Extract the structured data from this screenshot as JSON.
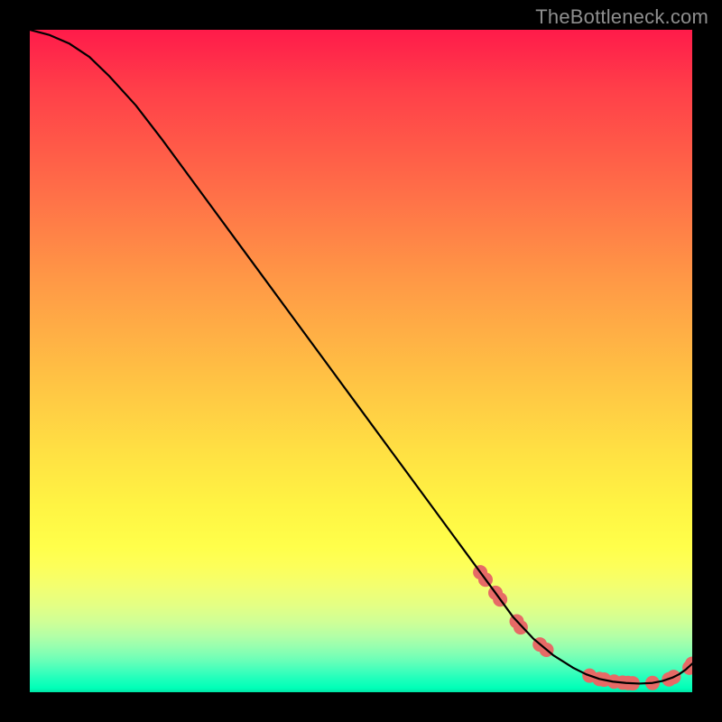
{
  "watermark": "TheBottleneck.com",
  "chart_data": {
    "type": "line",
    "title": "",
    "xlabel": "",
    "ylabel": "",
    "xlim": [
      0,
      100
    ],
    "ylim": [
      0,
      100
    ],
    "grid": false,
    "legend": false,
    "series": [
      {
        "name": "curve",
        "color": "#000000",
        "x": [
          0,
          3,
          6,
          9,
          12,
          16,
          20,
          25,
          30,
          35,
          40,
          45,
          50,
          55,
          60,
          65,
          70,
          73,
          76,
          79,
          82,
          84,
          86,
          88,
          90,
          92,
          94,
          95.5,
          97,
          98,
          99,
          100
        ],
        "y": [
          100,
          99.2,
          97.9,
          95.9,
          93.0,
          88.6,
          83.4,
          76.6,
          69.8,
          63.0,
          56.2,
          49.4,
          42.6,
          35.8,
          29.0,
          22.2,
          15.4,
          11.3,
          8.1,
          5.6,
          3.7,
          2.7,
          2.0,
          1.6,
          1.4,
          1.3,
          1.4,
          1.7,
          2.2,
          2.7,
          3.4,
          4.3
        ]
      }
    ],
    "markers": {
      "name": "points",
      "color": "#e66a66",
      "radius": 8,
      "x": [
        68.0,
        68.8,
        70.3,
        71.0,
        73.5,
        74.1,
        77.0,
        78.0,
        84.5,
        86.0,
        86.7,
        88.2,
        89.5,
        90.3,
        91.0,
        94.0,
        96.5,
        97.2,
        99.6,
        100.0
      ],
      "y": [
        18.1,
        17.0,
        15.0,
        14.0,
        10.7,
        9.8,
        7.2,
        6.4,
        2.5,
        2.0,
        1.9,
        1.6,
        1.45,
        1.4,
        1.35,
        1.4,
        1.95,
        2.3,
        3.7,
        4.3
      ]
    }
  }
}
